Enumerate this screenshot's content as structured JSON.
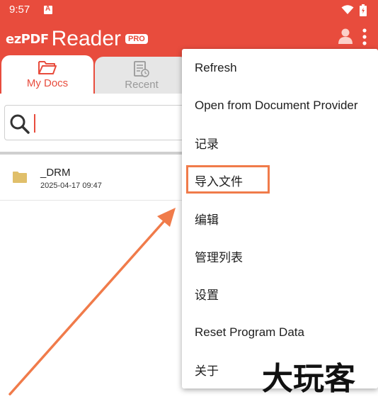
{
  "status_bar": {
    "time": "9:57",
    "icons": [
      "a-notification-icon",
      "wifi-icon",
      "battery-icon"
    ]
  },
  "app_bar": {
    "logo_ez": "ezPDF",
    "logo_reader": "Reader",
    "logo_badge": "PRO",
    "actions": [
      "account-icon",
      "more-vert-icon"
    ]
  },
  "tabs": [
    {
      "label": "My Docs",
      "icon": "folder-open-icon",
      "selected": true
    },
    {
      "label": "Recent",
      "icon": "recent-doc-icon",
      "selected": false
    }
  ],
  "search": {
    "value": "",
    "placeholder": ""
  },
  "files": [
    {
      "name": "_DRM",
      "date": "2025-04-17 09:47",
      "icon": "folder-icon"
    }
  ],
  "menu": {
    "items": [
      {
        "label": "Refresh"
      },
      {
        "label": "Open from Document Provider"
      },
      {
        "label": "记录"
      },
      {
        "label": "导入文件",
        "highlighted": true
      },
      {
        "label": "编辑"
      },
      {
        "label": "管理列表"
      },
      {
        "label": "设置"
      },
      {
        "label": "Reset Program Data"
      },
      {
        "label": "关于"
      }
    ]
  },
  "annotation": {
    "highlight_color": "#f07b4a",
    "arrow_color": "#f07b4a"
  },
  "watermark": {
    "text": "大玩客"
  },
  "colors": {
    "brand": "#e84c3d",
    "tab_inactive": "#e6e6e6"
  }
}
